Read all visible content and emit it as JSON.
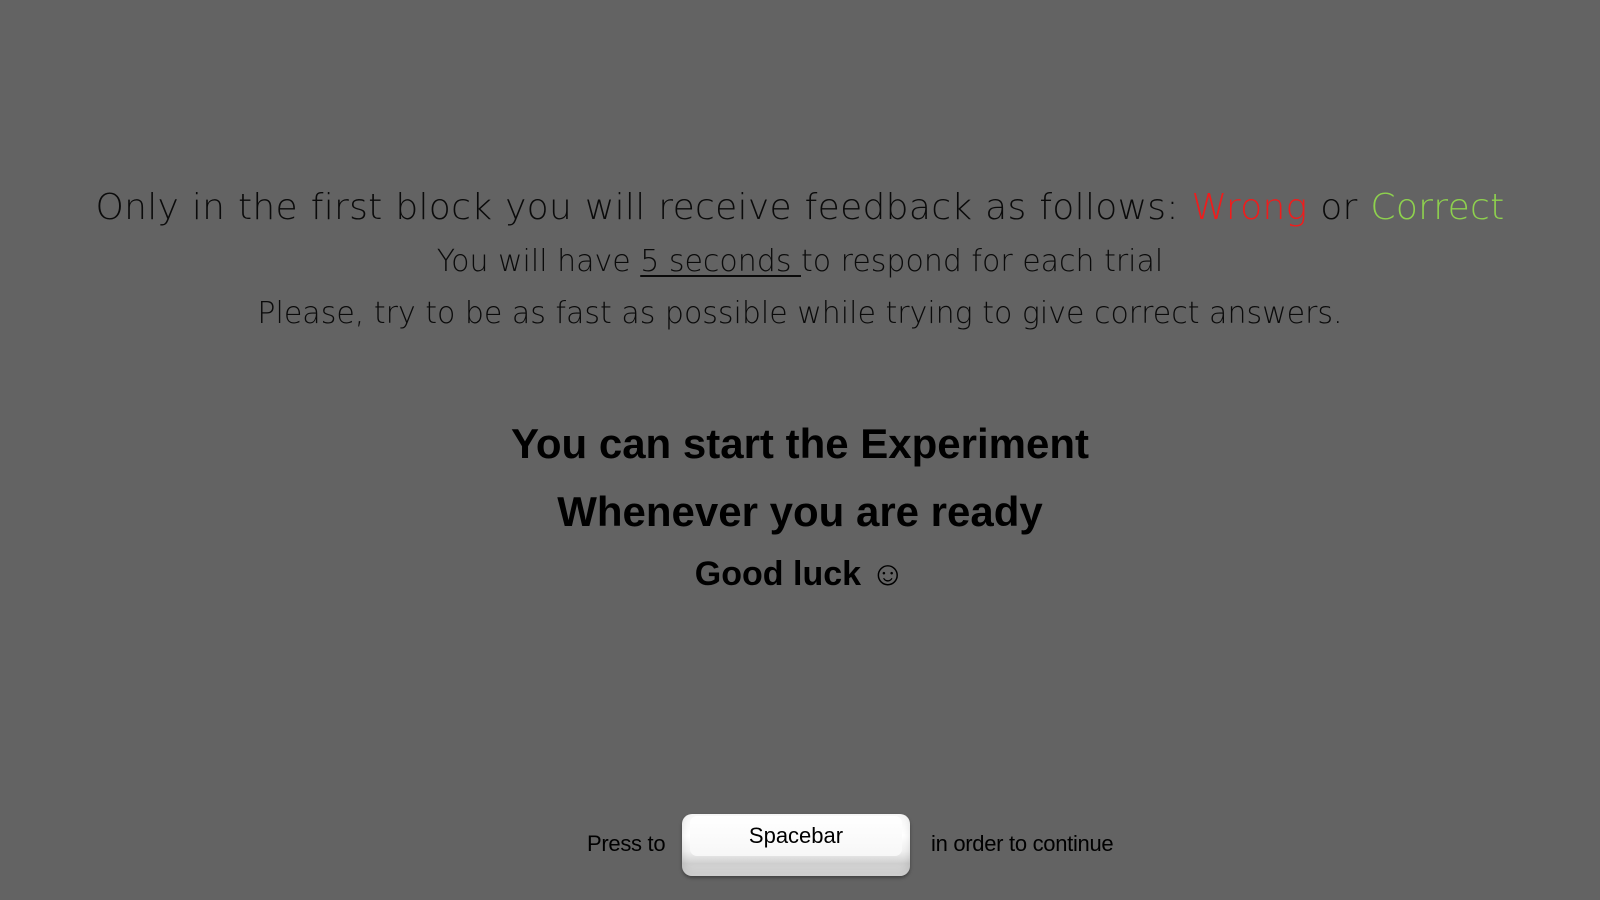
{
  "instructions": {
    "line1_prefix": "Only in the first block you will receive feedback as follows: ",
    "wrong_label": "Wrong",
    "or_word": " or ",
    "correct_label": "Correct",
    "line2_prefix": "You will have ",
    "line2_emphasis": "5 seconds ",
    "line2_suffix": "to respond for each trial",
    "line3": "Please, try to be as fast as possible while trying to give correct answers."
  },
  "start": {
    "heading1": "You can start the Experiment",
    "heading2": "Whenever you are ready",
    "heading3": "Good luck ☺"
  },
  "footer": {
    "press_text": "Press to",
    "key_label": "Spacebar",
    "continue_text": "in order to continue"
  },
  "colors": {
    "background": "#636363",
    "wrong": "#f01c1c",
    "correct": "#8ed14e"
  }
}
